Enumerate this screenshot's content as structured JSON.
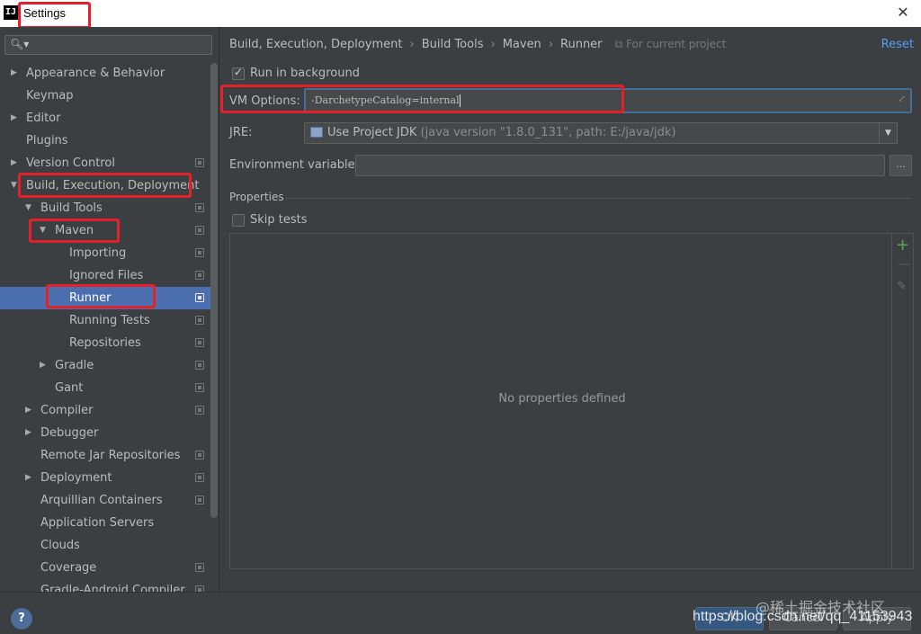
{
  "window": {
    "title": "Settings",
    "app_icon": "IJ",
    "close_glyph": "✕"
  },
  "sidebar": {
    "search_placeholder": "",
    "items": [
      {
        "label": "Appearance & Behavior",
        "level": 0,
        "arrow": "▶",
        "project": false
      },
      {
        "label": "Keymap",
        "level": 0,
        "arrow": "",
        "project": false
      },
      {
        "label": "Editor",
        "level": 0,
        "arrow": "▶",
        "project": false
      },
      {
        "label": "Plugins",
        "level": 0,
        "arrow": "",
        "project": false
      },
      {
        "label": "Version Control",
        "level": 0,
        "arrow": "▶",
        "project": true
      },
      {
        "label": "Build, Execution, Deployment",
        "level": 0,
        "arrow": "▼",
        "project": false
      },
      {
        "label": "Build Tools",
        "level": 1,
        "arrow": "▼",
        "project": true
      },
      {
        "label": "Maven",
        "level": 2,
        "arrow": "▼",
        "project": true
      },
      {
        "label": "Importing",
        "level": 3,
        "arrow": "",
        "project": true
      },
      {
        "label": "Ignored Files",
        "level": 3,
        "arrow": "",
        "project": true
      },
      {
        "label": "Runner",
        "level": 3,
        "arrow": "",
        "project": true,
        "selected": true
      },
      {
        "label": "Running Tests",
        "level": 3,
        "arrow": "",
        "project": true
      },
      {
        "label": "Repositories",
        "level": 3,
        "arrow": "",
        "project": true
      },
      {
        "label": "Gradle",
        "level": 2,
        "arrow": "▶",
        "project": true
      },
      {
        "label": "Gant",
        "level": 2,
        "arrow": "",
        "project": true
      },
      {
        "label": "Compiler",
        "level": 1,
        "arrow": "▶",
        "project": true
      },
      {
        "label": "Debugger",
        "level": 1,
        "arrow": "▶",
        "project": false
      },
      {
        "label": "Remote Jar Repositories",
        "level": 1,
        "arrow": "",
        "project": true
      },
      {
        "label": "Deployment",
        "level": 1,
        "arrow": "▶",
        "project": true
      },
      {
        "label": "Arquillian Containers",
        "level": 1,
        "arrow": "",
        "project": true
      },
      {
        "label": "Application Servers",
        "level": 1,
        "arrow": "",
        "project": false
      },
      {
        "label": "Clouds",
        "level": 1,
        "arrow": "",
        "project": false
      },
      {
        "label": "Coverage",
        "level": 1,
        "arrow": "",
        "project": true
      },
      {
        "label": "Gradle-Android Compiler",
        "level": 1,
        "arrow": "",
        "project": true
      }
    ]
  },
  "breadcrumb": {
    "parts": [
      "Build, Execution, Deployment",
      "Build Tools",
      "Maven",
      "Runner"
    ],
    "separator": "›",
    "scope": "For current project",
    "reset": "Reset"
  },
  "form": {
    "run_in_background": {
      "label": "Run in background",
      "checked": true
    },
    "vm_options": {
      "label": "VM Options:",
      "value": "-DarchetypeCatalog=internal"
    },
    "jre": {
      "label": "JRE:",
      "value": "Use Project JDK",
      "detail": "(java version \"1.8.0_131\", path: E:/java/jdk)"
    },
    "env_vars": {
      "label": "Environment variables:",
      "value": "",
      "button": "..."
    },
    "properties": {
      "title": "Properties",
      "skip_tests": {
        "label": "Skip tests",
        "checked": false
      },
      "empty_text": "No properties defined",
      "add": "+",
      "remove": "—",
      "edit": "✎"
    }
  },
  "footer": {
    "help": "?",
    "ok": "OK",
    "cancel": "Cancel",
    "apply": "Apply",
    "watermark_cn": "@稀土掘金技术社区",
    "watermark_url": "https://blog.csdn.net/qq_41153943"
  }
}
